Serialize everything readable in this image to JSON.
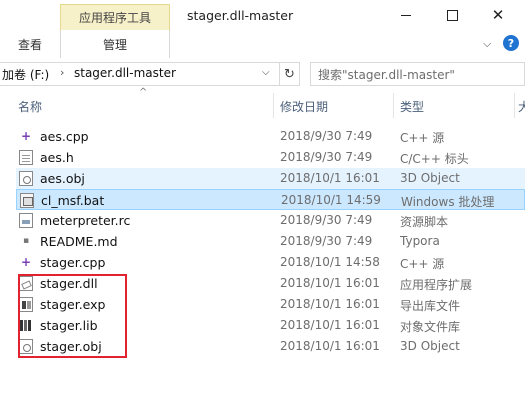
{
  "titlebar": {
    "context_tab": "应用程序工具",
    "title": "stager.dll-master",
    "minimize": "—",
    "close": "✕"
  },
  "ribbon": {
    "tab_view": "查看",
    "tab_manage": "管理",
    "toggle": "⌵",
    "help": "?"
  },
  "address": {
    "drive": "加卷 (F:)",
    "sep": "›",
    "folder": "stager.dll-master",
    "dropdown": "⌵",
    "refresh": "↻",
    "search_placeholder": "搜索\"stager.dll-master\""
  },
  "columns": {
    "name": "名称",
    "date": "修改日期",
    "type": "类型",
    "extra": "大",
    "sort_indicator": "^"
  },
  "files": [
    {
      "name": "aes.cpp",
      "date": "2018/9/30 7:49",
      "type": "C++ 源",
      "icon": "cpp-file-icon"
    },
    {
      "name": "aes.h",
      "date": "2018/9/30 7:49",
      "type": "C/C++ 标头",
      "icon": "header-file-icon"
    },
    {
      "name": "aes.obj",
      "date": "2018/10/1 16:01",
      "type": "3D Object",
      "icon": "object-file-icon"
    },
    {
      "name": "cl_msf.bat",
      "date": "2018/10/1 14:59",
      "type": "Windows 批处理",
      "icon": "batch-file-icon"
    },
    {
      "name": "meterpreter.rc",
      "date": "2018/9/30 7:49",
      "type": "资源脚本",
      "icon": "resource-file-icon"
    },
    {
      "name": "README.md",
      "date": "2018/9/30 7:49",
      "type": "Typora",
      "icon": "markdown-file-icon"
    },
    {
      "name": "stager.cpp",
      "date": "2018/10/1 14:58",
      "type": "C++ 源",
      "icon": "cpp-file-icon"
    },
    {
      "name": "stager.dll",
      "date": "2018/10/1 16:01",
      "type": "应用程序扩展",
      "icon": "dll-file-icon"
    },
    {
      "name": "stager.exp",
      "date": "2018/10/1 16:01",
      "type": "导出库文件",
      "icon": "exp-file-icon"
    },
    {
      "name": "stager.lib",
      "date": "2018/10/1 16:01",
      "type": "对象文件库",
      "icon": "lib-file-icon"
    },
    {
      "name": "stager.obj",
      "date": "2018/10/1 16:01",
      "type": "3D Object",
      "icon": "object-file-icon"
    }
  ],
  "colors": {
    "selection_bg": "#cce8ff",
    "hover_bg": "#e5f3ff",
    "highlight_border": "#e0232e",
    "context_tab_bg": "#f7f1c9"
  }
}
